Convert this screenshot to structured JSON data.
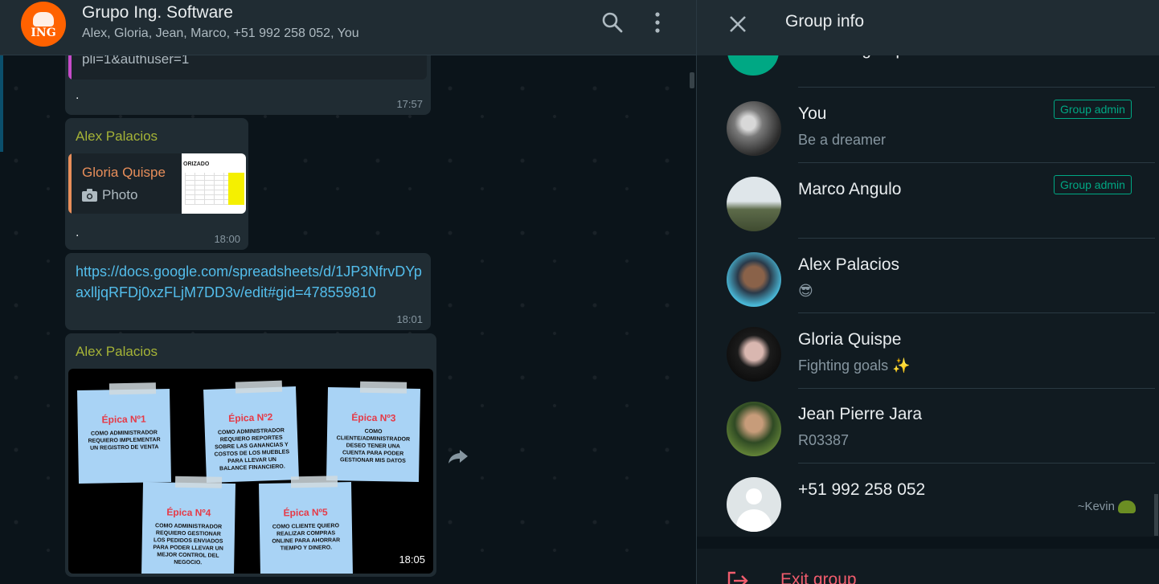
{
  "chat": {
    "header": {
      "avatar_text": "ING",
      "title": "Grupo Ing. Software",
      "participants": "Alex, Gloria, Jean, Marco, +51 992 258 052, You",
      "search_icon": "search-icon",
      "menu_icon": "more-vertical-icon"
    },
    "messages": [
      {
        "quote_text": "pli=1&authuser=1",
        "body": ".",
        "time": "17:57"
      },
      {
        "sender": "Alex Palacios",
        "quote_name": "Gloria Quispe",
        "quote_type": "Photo",
        "body": ".",
        "time": "18:00"
      },
      {
        "link": "https://docs.google.com/spreadsheets/d/1JP3NfrvDYpaxlljqRFDj0xzFLjM7DD3v/edit#gid=478559810",
        "time": "18:01"
      },
      {
        "sender": "Alex Palacios",
        "time": "18:05",
        "notes": [
          {
            "title": "Épica Nº1",
            "body": "COMO ADMINISTRADOR REQUIERO IMPLEMENTAR UN REGISTRO DE VENTA"
          },
          {
            "title": "Épica Nº2",
            "body": "COMO ADMINISTRADOR REQUIERO REPORTES SOBRE LAS GANANCIAS Y COSTOS DE LOS MUEBLES PARA LLEVAR UN BALANCE FINANCIERO."
          },
          {
            "title": "Épica Nº3",
            "body": "COMO CLIENTE/ADMINISTRADOR DESEO TENER UNA CUENTA PARA PODER GESTIONAR MIS DATOS"
          },
          {
            "title": "Épica Nº4",
            "body": "COMO ADMINISTRADOR REQUIERO GESTIONAR LOS PEDIDOS ENVIADOS PARA PODER LLEVAR UN MEJOR CONTROL DEL NEGOCIO."
          },
          {
            "title": "Épica Nº5",
            "body": "COMO CLIENTE QUIERO REALIZAR COMPRAS ONLINE PARA AHORRAR TIEMPO Y DINERO."
          }
        ],
        "thumb_title": "ORIZADO"
      }
    ]
  },
  "info": {
    "title": "Group info",
    "close_icon": "close-icon",
    "invite_label": "Invite to group via link",
    "members": [
      {
        "name": "You",
        "status": "Be a dreamer",
        "badge": "Group admin"
      },
      {
        "name": "Marco Angulo",
        "status": "",
        "badge": "Group admin"
      },
      {
        "name": "Alex Palacios",
        "status": "😎",
        "badge": ""
      },
      {
        "name": "Gloria Quispe",
        "status": "Fighting goals ✨",
        "badge": ""
      },
      {
        "name": "Jean Pierre Jara",
        "status": "R03387",
        "badge": ""
      },
      {
        "name": "+51 992 258 052",
        "status": "",
        "badge": "",
        "push_name": "~Kevin"
      }
    ],
    "exit_label": "Exit group"
  },
  "colors": {
    "accent": "#00a884",
    "danger": "#f15c6d",
    "link": "#53bdeb",
    "sender": "#a5b337"
  }
}
